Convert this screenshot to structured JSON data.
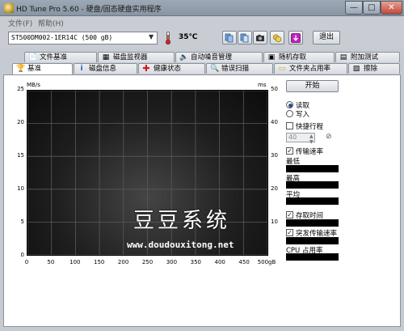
{
  "window": {
    "title": "HD Tune Pro 5.60 - 硬盘/固态硬盘实用程序",
    "controls": {
      "minimize": "—",
      "maximize": "□",
      "close": "✕"
    }
  },
  "menu": {
    "file": "文件(F)",
    "help": "帮助(H)"
  },
  "toolbar": {
    "drive": "ST500DM002-1ER14C (500 gB)",
    "temperature": "35℃",
    "exit_label": "退出",
    "icons": [
      "copy-icon",
      "copy-alt-icon",
      "camera-icon",
      "coins-icon",
      "download-icon"
    ]
  },
  "tabs_top": [
    {
      "label": "文件基准",
      "icon": "file-benchmark-icon"
    },
    {
      "label": "磁盘监视器",
      "icon": "disk-monitor-icon"
    },
    {
      "label": "自动噪音管理",
      "icon": "speaker-icon"
    },
    {
      "label": "随机存取",
      "icon": "random-access-icon"
    },
    {
      "label": "附加测试",
      "icon": "extra-tests-icon"
    }
  ],
  "tabs_bottom": [
    {
      "label": "基准",
      "icon": "benchmark-icon",
      "active": true
    },
    {
      "label": "磁盘信息",
      "icon": "info-icon"
    },
    {
      "label": "健康状态",
      "icon": "health-cross-icon"
    },
    {
      "label": "错误扫描",
      "icon": "error-scan-icon"
    },
    {
      "label": "文件夹占用率",
      "icon": "folder-usage-icon"
    },
    {
      "label": "擦除",
      "icon": "erase-icon"
    }
  ],
  "chart_data": {
    "type": "line",
    "title": "",
    "ylabel_left": "MB/s",
    "ylabel_right": "ms",
    "xlabel": "",
    "ylim_left": [
      0,
      25
    ],
    "ylim_right": [
      0,
      50
    ],
    "xlim": [
      0,
      500
    ],
    "y_ticks_left": [
      "25",
      "20",
      "15",
      "10",
      "5",
      "0"
    ],
    "y_ticks_right": [
      "50",
      "40",
      "30",
      "20",
      "10"
    ],
    "x_ticks": [
      "0",
      "50",
      "100",
      "150",
      "200",
      "250",
      "300",
      "350",
      "400",
      "450",
      "500gB"
    ],
    "series": [],
    "grid": true
  },
  "watermark": {
    "text": "豆豆系统",
    "url": "www.doudouxitong.net"
  },
  "controls": {
    "start_label": "开始",
    "read_label": "读取",
    "write_label": "写入",
    "mode": "read",
    "short_stroke_label": "快捷行程",
    "short_stroke_checked": false,
    "short_stroke_value": "40",
    "transfer_rate_label": "传输速率",
    "transfer_rate_checked": true,
    "min_label": "最低",
    "max_label": "最高",
    "avg_label": "平均",
    "access_time_label": "存取时间",
    "access_time_checked": true,
    "burst_rate_label": "突发传输速率",
    "burst_rate_checked": true,
    "cpu_label": "CPU 占用率"
  },
  "colors": {
    "chart_bg": "#1e1e1e",
    "grid": "#5a5a5a",
    "panel_bg": "#ffffff",
    "chrome": "#c9cdd3"
  }
}
